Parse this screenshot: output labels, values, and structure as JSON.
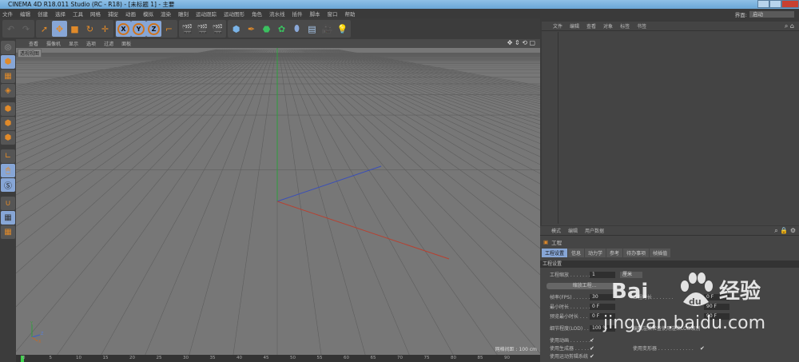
{
  "title": "CINEMA 4D R18.011 Studio (RC - R18) - [未标题 1] - 主要",
  "menu": [
    "文件",
    "编辑",
    "创建",
    "选择",
    "工具",
    "网格",
    "捕捉",
    "动画",
    "模拟",
    "渲染",
    "雕刻",
    "运动跟踪",
    "运动图形",
    "角色",
    "流水线",
    "插件",
    "脚本",
    "窗口",
    "帮助"
  ],
  "layout": {
    "label": "界面:",
    "value": "启动"
  },
  "viewport": {
    "menu": [
      "查看",
      "摄像机",
      "显示",
      "选项",
      "过滤",
      "面板"
    ],
    "label": "透视视图",
    "grid_info": "网格间距 : 100 cm",
    "axes": {
      "y": "Y",
      "z": "Z",
      "x": "X"
    }
  },
  "timeline": {
    "ticks": [
      "0",
      "5",
      "10",
      "15",
      "20",
      "25",
      "30",
      "35",
      "40",
      "45",
      "50",
      "55",
      "60",
      "65",
      "70",
      "75",
      "80",
      "85",
      "90"
    ]
  },
  "object_manager": {
    "menu": [
      "文件",
      "编辑",
      "查看",
      "对象",
      "标签",
      "书签"
    ]
  },
  "attributes": {
    "menu": [
      "模式",
      "编辑",
      "用户数据"
    ],
    "title": "工程",
    "tabs": [
      "工程设置",
      "信息",
      "动力学",
      "参考",
      "待办事项",
      "帧插值"
    ],
    "section": "工程设置",
    "scale_label": "工程缩放 . . . . . . . .",
    "scale_value": "1",
    "scale_unit": "厘米",
    "scale_button": "缩放工程...",
    "fps_label": "帧率(FPS) . . . . . . .",
    "fps_value": "30",
    "duration_label": "工程时长 . . . . . . .",
    "duration_value": "0 F",
    "min_label": "最小时长 . . . . . . .",
    "min_value": "0 F",
    "max_value": "90 F",
    "pmin_label": "预览最小时长 . . .",
    "pmin_value": "0 F",
    "pmax_value": "90 F",
    "lod_label": "细节程度(LOD) . . .",
    "lod_value": "100 %",
    "lod_render_label": "编辑渲染检查使用渲染LOD级别",
    "anim_label": "使用动画 . . . . . . . .",
    "gen_label": "使用生成器 . . . . . .",
    "deform_label": "使用变形器 . . . . . . . . . . . .",
    "motion_label": "使用运动剪辑系统"
  },
  "watermark": {
    "logo": "Bai",
    "logo2": "du",
    "cn": "经验",
    "url": "jingyan.baidu.com"
  },
  "colors": {
    "accent": "#87a6d6",
    "x_axis": "#c0392b",
    "y_axis": "#2e9e3e",
    "z_axis": "#3a4fb8"
  }
}
